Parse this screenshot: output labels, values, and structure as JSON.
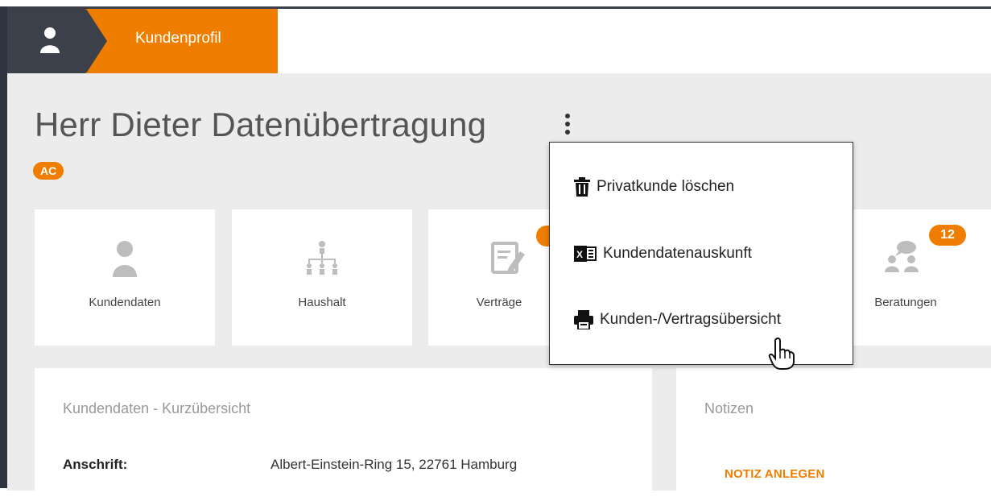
{
  "header": {
    "breadcrumb_label": "Kundenprofil"
  },
  "customer": {
    "name": "Herr Dieter Datenübertragung",
    "badge": "AC"
  },
  "tiles": [
    {
      "label": "Kundendaten"
    },
    {
      "label": "Haushalt"
    },
    {
      "label": "Verträge"
    },
    {
      "label": "Beratungen",
      "count": "12"
    }
  ],
  "context_menu": {
    "items": [
      {
        "label": "Privatkunde löschen",
        "icon": "trash-icon"
      },
      {
        "label": "Kundendatenauskunft",
        "icon": "excel-icon"
      },
      {
        "label": "Kunden-/Vertragsübersicht",
        "icon": "printer-icon"
      }
    ]
  },
  "summary": {
    "title": "Kundendaten - Kurzübersicht",
    "address_label": "Anschrift:",
    "address_value": "Albert-Einstein-Ring 15, 22761 Hamburg"
  },
  "notes": {
    "title": "Notizen",
    "action_label": "NOTIZ ANLEGEN"
  },
  "colors": {
    "accent": "#ef7d00",
    "dark": "#3b404a",
    "background": "#ececec"
  }
}
